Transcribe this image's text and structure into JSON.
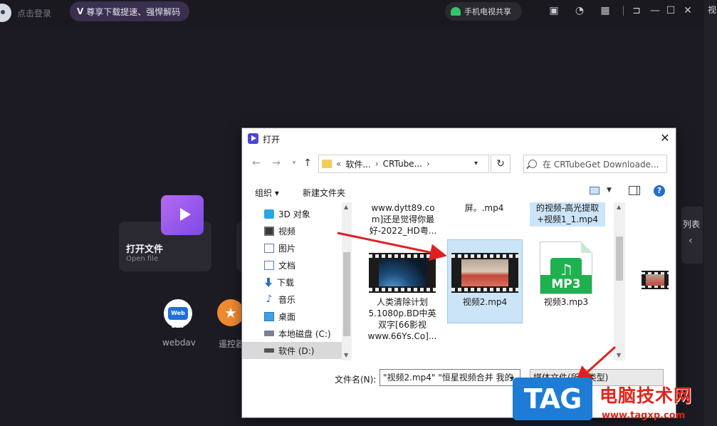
{
  "app": {
    "login_text": "点击登录",
    "vip_badge": "V",
    "vip_text": "尊享下载提速、强悍解码",
    "tv_share": "手机电视共享",
    "open_file_title": "打开文件",
    "open_file_sub": "Open file",
    "webdav_icon_text": "Web DAV",
    "webdav_label": "webdav",
    "remote_label": "遥控器",
    "list_tab_label": "列表",
    "right_strip_label": "视"
  },
  "dialog": {
    "title": "打开",
    "address": {
      "prefix": "«",
      "segment1": "软件...",
      "segment2": "CRTube..."
    },
    "search_placeholder": "在 CRTubeGet Downloade...",
    "toolbar": {
      "organize": "组织 ▾",
      "new_folder": "新建文件夹"
    },
    "nav_items": [
      {
        "label": "3D 对象",
        "icon": "3d-objects-icon"
      },
      {
        "label": "视频",
        "icon": "videos-icon"
      },
      {
        "label": "图片",
        "icon": "pictures-icon"
      },
      {
        "label": "文档",
        "icon": "documents-icon"
      },
      {
        "label": "下载",
        "icon": "downloads-icon"
      },
      {
        "label": "音乐",
        "icon": "music-icon"
      },
      {
        "label": "桌面",
        "icon": "desktop-icon"
      },
      {
        "label": "本地磁盘 (C:)",
        "icon": "drive-c-icon"
      },
      {
        "label": "软件 (D:)",
        "icon": "drive-d-icon"
      }
    ],
    "files": {
      "top1": "www.dytt89.co\nm]还是觉得你最\n好-2022_HD粤...",
      "top2": "屏。.mp4",
      "top3": "的视频-高光提取\n+视频1_1.mp4",
      "f1": "人类清除计划\n5.1080p.BD中英\n双字[66影视\nwww.66Ys.Co]...",
      "f2": "视频2.mp4",
      "f3": "视频3.mp3",
      "mp3_badge": "MP3"
    },
    "filename_label": "文件名(N):",
    "filename_value": "\"视频2.mp4\" \"恒星视频合并 我的",
    "filetype_value": "媒体文件(所有类型)"
  },
  "watermark": {
    "tag": "TAG",
    "site_name": "电脑技术网",
    "url": "www.tagxp.com"
  }
}
